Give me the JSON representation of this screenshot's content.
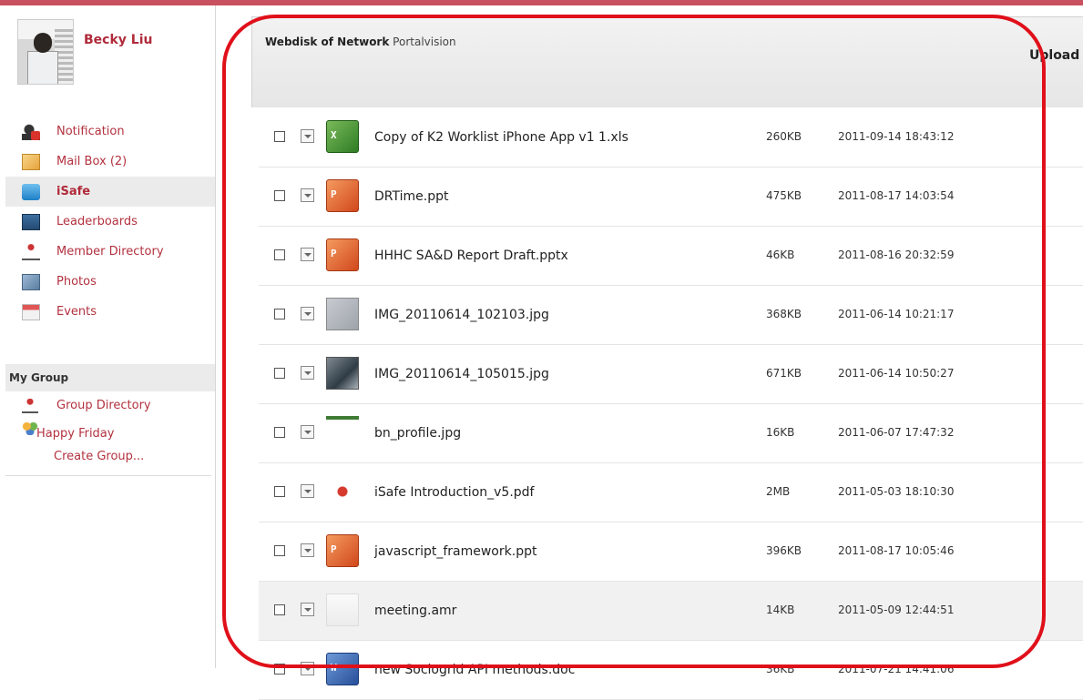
{
  "profile": {
    "name": "Becky Liu"
  },
  "nav": {
    "items": [
      {
        "label": "Notification",
        "icon": "notification-icon"
      },
      {
        "label": "Mail Box (2)",
        "icon": "mailbox-icon"
      },
      {
        "label": "iSafe",
        "icon": "isafe-icon",
        "active": true
      },
      {
        "label": "Leaderboards",
        "icon": "leaderboards-icon"
      },
      {
        "label": "Member Directory",
        "icon": "member-directory-icon"
      },
      {
        "label": "Photos",
        "icon": "photos-icon"
      },
      {
        "label": "Events",
        "icon": "events-icon"
      }
    ]
  },
  "group": {
    "header": "My Group",
    "directory": "Group Directory",
    "happy_friday": "Happy Friday",
    "create": "Create Group..."
  },
  "disk": {
    "title_bold": "Webdisk of Network",
    "title_sub": "Portalvision",
    "upload_label": "Upload"
  },
  "files": [
    {
      "name": "Copy of K2 Worklist iPhone App v1 1.xls",
      "size": "260KB",
      "date": "2011-09-14 18:43:12",
      "type": "xls"
    },
    {
      "name": "DRTime.ppt",
      "size": "475KB",
      "date": "2011-08-17 14:03:54",
      "type": "ppt"
    },
    {
      "name": "HHHC SA&D Report Draft.pptx",
      "size": "46KB",
      "date": "2011-08-16 20:32:59",
      "type": "ppt"
    },
    {
      "name": "IMG_20110614_102103.jpg",
      "size": "368KB",
      "date": "2011-06-14 10:21:17",
      "type": "jpg"
    },
    {
      "name": "IMG_20110614_105015.jpg",
      "size": "671KB",
      "date": "2011-06-14 10:50:27",
      "type": "jpg"
    },
    {
      "name": "bn_profile.jpg",
      "size": "16KB",
      "date": "2011-06-07 17:47:32",
      "type": "jpg"
    },
    {
      "name": "iSafe Introduction_v5.pdf",
      "size": "2MB",
      "date": "2011-05-03 18:10:30",
      "type": "pdf"
    },
    {
      "name": "javascript_framework.ppt",
      "size": "396KB",
      "date": "2011-08-17 10:05:46",
      "type": "ppt"
    },
    {
      "name": "meeting.amr",
      "size": "14KB",
      "date": "2011-05-09 12:44:51",
      "type": "amr"
    },
    {
      "name": "new Sociogrid API methods.doc",
      "size": "36KB",
      "date": "2011-07-21 14:41:06",
      "type": "doc"
    }
  ],
  "colors": {
    "accent": "#b3313f",
    "topbar": "#c9505f",
    "highlight": "#e0101a"
  }
}
